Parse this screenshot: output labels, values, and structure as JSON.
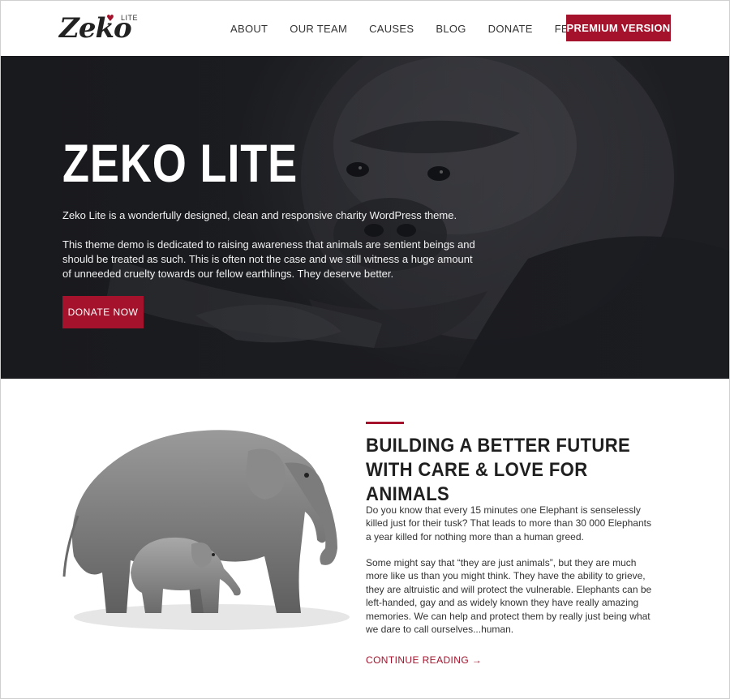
{
  "header": {
    "logo_text": "Zeko",
    "logo_badge": "LITE",
    "nav": [
      {
        "label": "ABOUT"
      },
      {
        "label": "OUR TEAM"
      },
      {
        "label": "CAUSES"
      },
      {
        "label": "BLOG"
      },
      {
        "label": "DONATE"
      },
      {
        "label": "FEATURES"
      }
    ],
    "features_icon": "chevron-down-icon",
    "premium_label": "PREMIUM VERSION"
  },
  "hero": {
    "title": "ZEKO LITE",
    "paragraph1": "Zeko Lite is a wonderfully designed, clean and responsive charity WordPress theme.",
    "paragraph2": "This theme demo is dedicated to raising awareness that animals are sentient beings and should be treated as such. This is often not the case and we still witness a huge amount of unneeded cruelty towards our fellow earthlings. They deserve better.",
    "donate_label": "DONATE NOW"
  },
  "section": {
    "title": "BUILDING A BETTER FUTURE WITH CARE & LOVE FOR ANIMALS",
    "paragraph1": "Do you know that every 15 minutes one Elephant is senselessly killed just for their tusk? That leads to more than 30 000 Elephants a year killed for nothing more than a human greed.",
    "paragraph2": "Some might say that “they are just animals”, but they are much more like us than you might think. They have the ability to grieve, they are altruistic and will protect the vulnerable. Elephants can be left-handed, gay and as widely known they have really amazing memories. We can help and protect them by really just being what we dare to call ourselves...human.",
    "continue_label": "CONTINUE READING →"
  },
  "colors": {
    "accent": "#a4122b",
    "hero_bg": "#2a2b2f",
    "text": "#222222"
  }
}
